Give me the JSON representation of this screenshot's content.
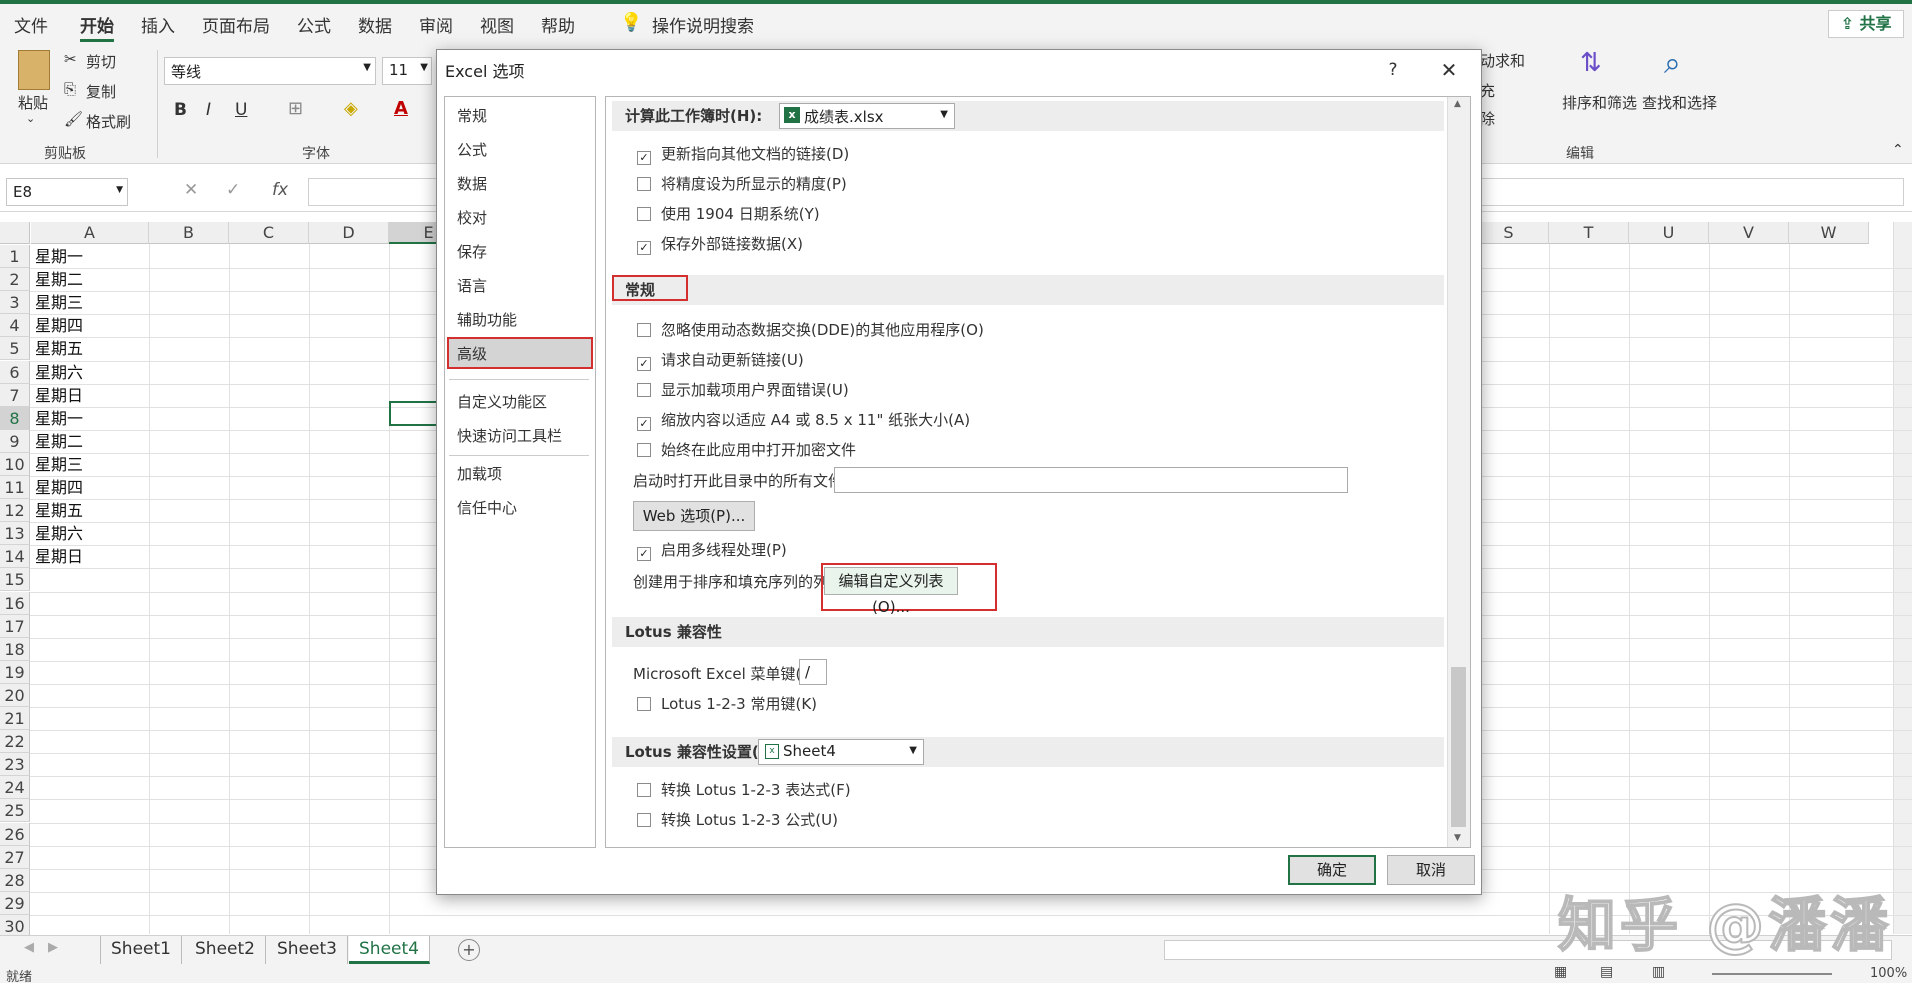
{
  "menu": {
    "items": [
      "文件",
      "开始",
      "插入",
      "页面布局",
      "公式",
      "数据",
      "审阅",
      "视图",
      "帮助"
    ],
    "tell_me": "操作说明搜索",
    "share": "共享"
  },
  "ribbon": {
    "paste": "粘贴",
    "cut": "剪切",
    "copy": "复制",
    "format_painter": "格式刷",
    "clipboard_group": "剪贴板",
    "font_name": "等线",
    "font_size": "11",
    "bold": "B",
    "italic": "I",
    "underline": "U",
    "font_color_letter": "A",
    "font_group": "字体",
    "autosum_partial": "动求和",
    "fill_partial": "充",
    "clear_partial": "除",
    "sort_filter": "排序和筛选",
    "find_select": "查找和选择",
    "edit_group": "编辑"
  },
  "formula_bar": {
    "name_box": "E8",
    "fx": "fx"
  },
  "columns_left": [
    "A",
    "B",
    "C",
    "D",
    "E"
  ],
  "columns_right": [
    "S",
    "T",
    "U",
    "V",
    "W"
  ],
  "rows": [
    "1",
    "2",
    "3",
    "4",
    "5",
    "6",
    "7",
    "8",
    "9",
    "10",
    "11",
    "12",
    "13",
    "14",
    "15",
    "16",
    "17",
    "18",
    "19",
    "20",
    "21",
    "22",
    "23",
    "24",
    "25",
    "26",
    "27",
    "28",
    "29",
    "30"
  ],
  "cells_a": [
    "星期一",
    "星期二",
    "星期三",
    "星期四",
    "星期五",
    "星期六",
    "星期日",
    "星期一",
    "星期二",
    "星期三",
    "星期四",
    "星期五",
    "星期六",
    "星期日"
  ],
  "sheets": [
    "Sheet1",
    "Sheet2",
    "Sheet3",
    "Sheet4"
  ],
  "active_sheet": "Sheet4",
  "status": {
    "ready": "就绪",
    "zoom": "100%"
  },
  "dialog": {
    "title": "Excel 选项",
    "help": "?",
    "close": "✕",
    "nav": [
      "常规",
      "公式",
      "数据",
      "校对",
      "保存",
      "语言",
      "辅助功能",
      "高级",
      "自定义功能区",
      "快速访问工具栏",
      "加载项",
      "信任中心"
    ],
    "selected_nav": "高级",
    "calc_label": "计算此工作簿时(H):",
    "calc_workbook": "成绩表.xlsx",
    "calc_opts": [
      {
        "label": "更新指向其他文档的链接(D)",
        "checked": true
      },
      {
        "label": "将精度设为所显示的精度(P)",
        "checked": false
      },
      {
        "label": "使用 1904 日期系统(Y)",
        "checked": false
      },
      {
        "label": "保存外部链接数据(X)",
        "checked": true
      }
    ],
    "general_title": "常规",
    "general_opts": [
      {
        "label": "忽略使用动态数据交换(DDE)的其他应用程序(O)",
        "checked": false
      },
      {
        "label": "请求自动更新链接(U)",
        "checked": true
      },
      {
        "label": "显示加载项用户界面错误(U)",
        "checked": false
      },
      {
        "label": "缩放内容以适应 A4 或 8.5 x 11\" 纸张大小(A)",
        "checked": true
      },
      {
        "label": "始终在此应用中打开加密文件",
        "checked": false
      }
    ],
    "startup_label": "启动时打开此目录中的所有文件(L):",
    "startup_value": "",
    "web_options": "Web 选项(P)...",
    "multithread": {
      "label": "启用多线程处理(P)",
      "checked": true
    },
    "custom_list_label": "创建用于排序和填充序列的列表:",
    "edit_custom_lists": "编辑自定义列表(O)...",
    "lotus_title": "Lotus 兼容性",
    "menu_key_label": "Microsoft Excel 菜单键(M):",
    "menu_key_value": "/",
    "lotus_nav": {
      "label": "Lotus 1-2-3 常用键(K)",
      "checked": false
    },
    "lotus_settings_label": "Lotus 兼容性设置(L):",
    "lotus_sheet": "Sheet4",
    "lotus_opts": [
      {
        "label": "转换 Lotus 1-2-3 表达式(F)",
        "checked": false
      },
      {
        "label": "转换 Lotus 1-2-3 公式(U)",
        "checked": false
      }
    ],
    "ok": "确定",
    "cancel": "取消"
  },
  "watermark": "知乎 @潘潘",
  "colors": {
    "accent": "#217346",
    "highlight": "#d32f2f"
  }
}
